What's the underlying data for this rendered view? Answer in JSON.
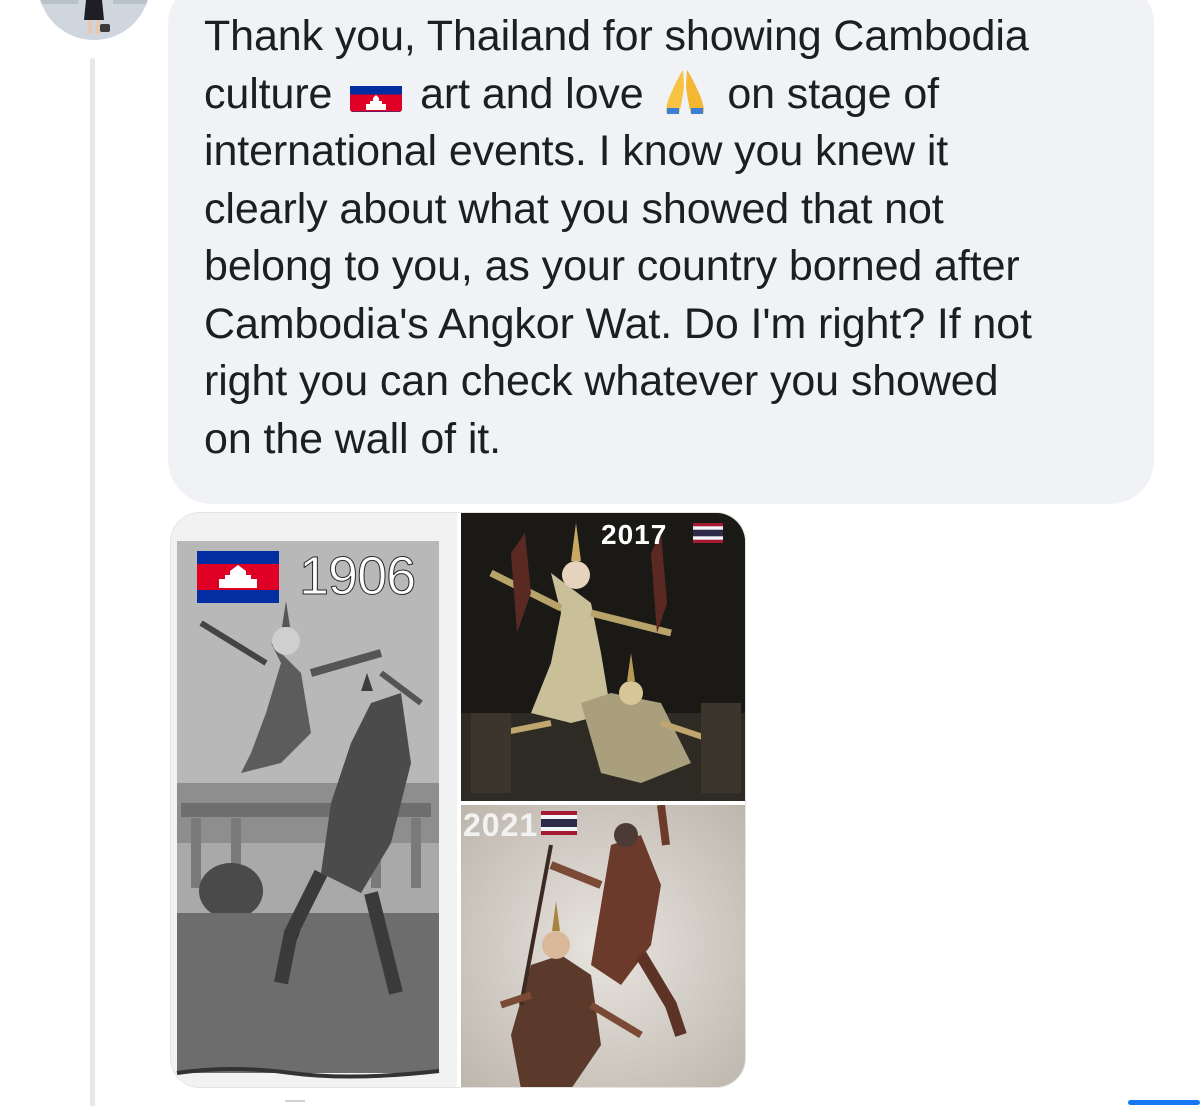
{
  "comment": {
    "line1": "Thank you, Thailand for showing Cambodia",
    "line2a": "culture",
    "line2b": "art and love",
    "line2c": "on stage of",
    "rest": [
      "international events. I know you knew it",
      "clearly about what you showed that not",
      "belong to you, as your country borned after",
      "Cambodia's Angkor Wat. Do I'm right? If not",
      "right you can check whatever you showed",
      "on the wall of it."
    ]
  },
  "icons": {
    "flag_inline": "cambodia-flag-icon",
    "pray": "folded-hands-icon"
  },
  "collage": {
    "label_1906": "1906",
    "label_2017": "2017",
    "label_2021": "2021"
  },
  "colors": {
    "bubble": "#f0f2f5",
    "text": "#1c1e21",
    "cambodia_blue": "#032ea1",
    "cambodia_red": "#e00025",
    "thai_red": "#a51931",
    "thai_blue": "#2d2a4a"
  }
}
